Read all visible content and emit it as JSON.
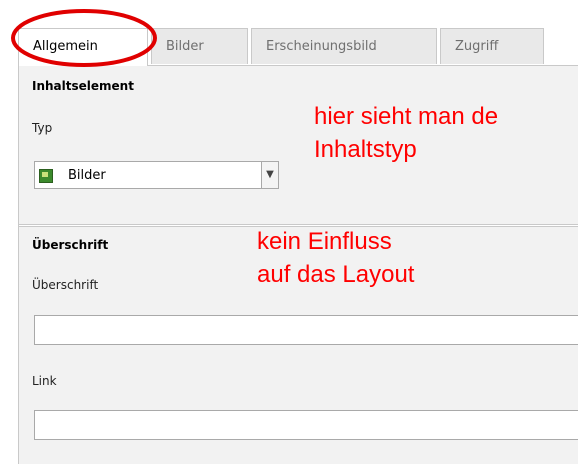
{
  "tabs": [
    {
      "label": "Allgemein",
      "active": true
    },
    {
      "label": "Bilder",
      "active": false
    },
    {
      "label": "Erscheinungsbild",
      "active": false
    },
    {
      "label": "Zugriff",
      "active": false
    }
  ],
  "section_content": {
    "title": "Inhaltselement",
    "type_label": "Typ",
    "type_value": "Bilder",
    "type_icon": "image-icon"
  },
  "section_header": {
    "title": "Überschrift",
    "header_label": "Überschrift",
    "header_value": "",
    "link_label": "Link",
    "link_value": ""
  },
  "annotations": {
    "type_note": [
      "hier sieht man de",
      "Inhaltstyp"
    ],
    "header_note": [
      "kein Einfluss",
      "auf das Layout"
    ],
    "color": "#ff0000"
  },
  "colors": {
    "panel_bg": "#f2f2f2",
    "border": "#c9c9c9",
    "tab_inactive_bg": "#e9e9e9"
  }
}
